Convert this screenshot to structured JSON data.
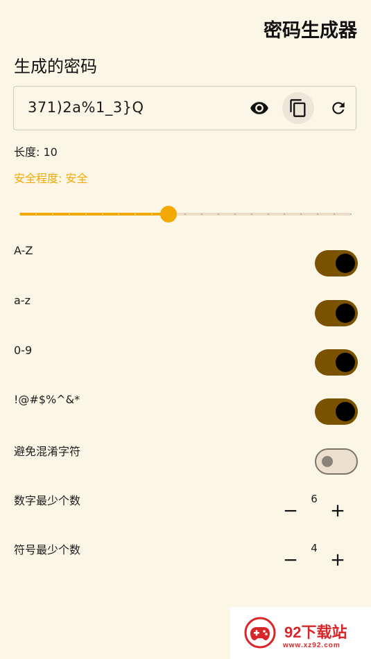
{
  "header": {
    "title": "密码生成器"
  },
  "generated": {
    "section_title": "生成的密码",
    "password": "371)2a%1_3}Q",
    "actions": [
      {
        "name": "toggle-visibility",
        "icon": "eye-icon"
      },
      {
        "name": "copy",
        "icon": "copy-icon"
      },
      {
        "name": "regenerate",
        "icon": "refresh-icon"
      }
    ]
  },
  "length": {
    "label": "长度: 10",
    "value": 10
  },
  "strength": {
    "label": "安全程度: 安全",
    "color": "#f3a800"
  },
  "slider": {
    "min": 1,
    "max": 21,
    "value": 10,
    "accent": "#f3a800"
  },
  "options": [
    {
      "label": "A-Z",
      "enabled": true
    },
    {
      "label": "a-z",
      "enabled": true
    },
    {
      "label": "0-9",
      "enabled": true
    },
    {
      "label": "!@#$%^&*",
      "enabled": true
    },
    {
      "label": "避免混淆字符",
      "enabled": false
    }
  ],
  "counts": [
    {
      "label": "数字最少个数",
      "value": "6"
    },
    {
      "label": "符号最少个数",
      "value": "4"
    }
  ],
  "watermark": {
    "name": "92下载站",
    "url": "www.xz92.com",
    "icon": "gamepad-logo-icon",
    "color": "#d8262a"
  },
  "colors": {
    "background": "#fcf6e6",
    "toggle_on": "#7a5200",
    "toggle_off": "#ebe0cd"
  }
}
